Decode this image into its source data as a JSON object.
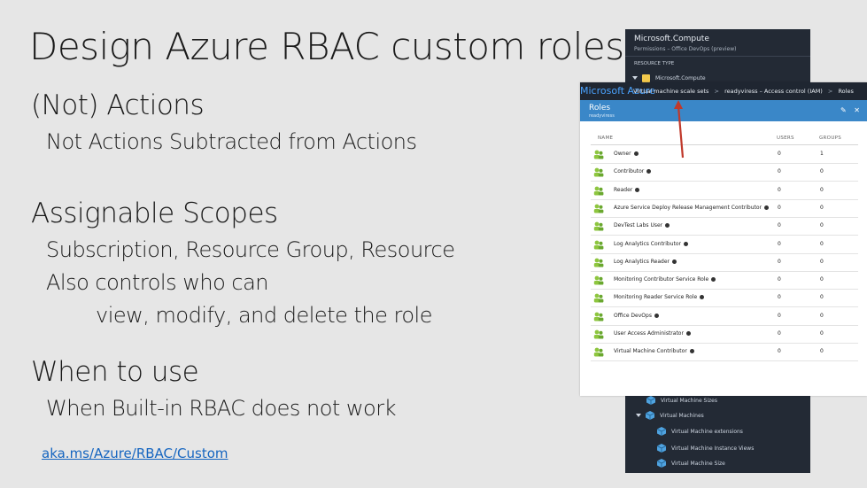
{
  "slide": {
    "title": "Design Azure RBAC custom roles",
    "section1": {
      "heading": "(Not) Actions",
      "line1": "Not Actions Subtracted from Actions"
    },
    "section2": {
      "heading": "Assignable Scopes",
      "line1": "Subscription, Resource Group, Resource",
      "line2": "Also controls who can",
      "line3": "view, modify, and delete the role"
    },
    "section3": {
      "heading": "When to use",
      "line1": "When Built-in RBAC does not work"
    },
    "link": "aka.ms/Azure/RBAC/Custom"
  },
  "dark_panel": {
    "title": "Microsoft.Compute",
    "subtitle": "Permissions – Office DevOps (preview)",
    "section_label": "RESOURCE TYPE",
    "top_item": "Microsoft.Compute",
    "items": [
      "Virtual Machine Sizes",
      "Virtual Machines",
      "Virtual Machine extensions",
      "Virtual Machine Instance Views",
      "Virtual Machine Size"
    ]
  },
  "azure_window": {
    "brand": "Microsoft Azure",
    "breadcrumbs": [
      "Virtual machine scale sets",
      ">",
      "readyviress – Access control (IAM)",
      ">",
      "Roles"
    ],
    "blade_title": "Roles",
    "blade_subtitle": "readyviress",
    "columns": {
      "name": "NAME",
      "users": "USERS",
      "groups": "GROUPS"
    },
    "roles": [
      {
        "name": "Owner",
        "users": "0",
        "groups": "1"
      },
      {
        "name": "Contributor",
        "users": "0",
        "groups": "0"
      },
      {
        "name": "Reader",
        "users": "0",
        "groups": "0"
      },
      {
        "name": "Azure Service Deploy Release Management Contributor",
        "users": "0",
        "groups": "0"
      },
      {
        "name": "DevTest Labs User",
        "users": "0",
        "groups": "0"
      },
      {
        "name": "Log Analytics Contributor",
        "users": "0",
        "groups": "0"
      },
      {
        "name": "Log Analytics Reader",
        "users": "0",
        "groups": "0"
      },
      {
        "name": "Monitoring Contributor Service Role",
        "users": "0",
        "groups": "0"
      },
      {
        "name": "Monitoring Reader Service Role",
        "users": "0",
        "groups": "0"
      },
      {
        "name": "Office DevOps",
        "users": "0",
        "groups": "0"
      },
      {
        "name": "User Access Administrator",
        "users": "0",
        "groups": "0"
      },
      {
        "name": "Virtual Machine Contributor",
        "users": "0",
        "groups": "0"
      }
    ]
  },
  "colors": {
    "slide_bg": "#e6e6e6",
    "portal_dark": "#232a35",
    "blade_blue": "#3a87c8",
    "link": "#1565c0",
    "arrow": "#c0392b"
  }
}
